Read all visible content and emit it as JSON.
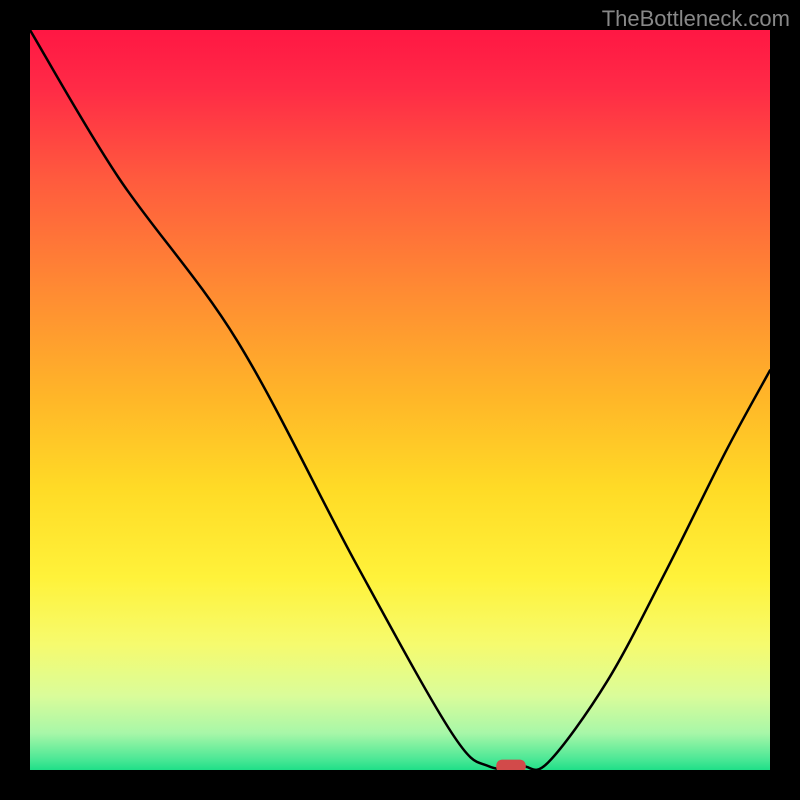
{
  "watermark": "TheBottleneck.com",
  "chart_data": {
    "type": "line",
    "title": "",
    "xlabel": "",
    "ylabel": "",
    "xlim": [
      0,
      100
    ],
    "ylim": [
      0,
      100
    ],
    "legend": null,
    "annotations": [],
    "series": [
      {
        "name": "curve",
        "x": [
          0,
          12,
          28,
          44,
          57,
          62,
          66.5,
          70,
          78,
          86,
          94,
          100
        ],
        "values": [
          100,
          80,
          58,
          28,
          5,
          0.5,
          0.5,
          1,
          12,
          27,
          43,
          54
        ]
      }
    ],
    "marker": {
      "x": 65,
      "y": 0.5,
      "width": 4,
      "height": 1.8,
      "color": "#d24a4a"
    },
    "gradient_stops": [
      {
        "offset": 0.0,
        "color": "#ff1744"
      },
      {
        "offset": 0.08,
        "color": "#ff2b46"
      },
      {
        "offset": 0.2,
        "color": "#ff5a3e"
      },
      {
        "offset": 0.35,
        "color": "#ff8a33"
      },
      {
        "offset": 0.5,
        "color": "#ffb728"
      },
      {
        "offset": 0.62,
        "color": "#ffdb26"
      },
      {
        "offset": 0.74,
        "color": "#fff23a"
      },
      {
        "offset": 0.83,
        "color": "#f6fb6e"
      },
      {
        "offset": 0.9,
        "color": "#dafc9a"
      },
      {
        "offset": 0.95,
        "color": "#a8f7a8"
      },
      {
        "offset": 0.985,
        "color": "#4de896"
      },
      {
        "offset": 1.0,
        "color": "#1fdf88"
      }
    ],
    "curve_stroke": "#000000",
    "curve_width": 2.5
  }
}
